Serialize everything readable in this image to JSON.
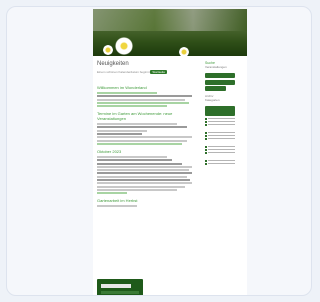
{
  "site": {
    "title": "Neuigkeiten",
    "subtitle_text": "Einem schönen Kalenderdatum beginnt ",
    "subtitle_tag": "Startseite"
  },
  "sidebar": {
    "heading": "Suche",
    "sub": "Veranstaltungen",
    "links": [
      "Archiv",
      "Kategorien"
    ]
  },
  "posts": [
    {
      "heading": "Willkommen im Wonderland"
    },
    {
      "heading": "Termine im Garten am Wochenende: neue Veranstaltungen"
    },
    {
      "heading": "Oktober 2023"
    },
    {
      "heading": "Gartenarbeit im Herbst"
    }
  ],
  "colors": {
    "accent_green": "#2e6f2a",
    "link_green": "#3f9a3a"
  }
}
